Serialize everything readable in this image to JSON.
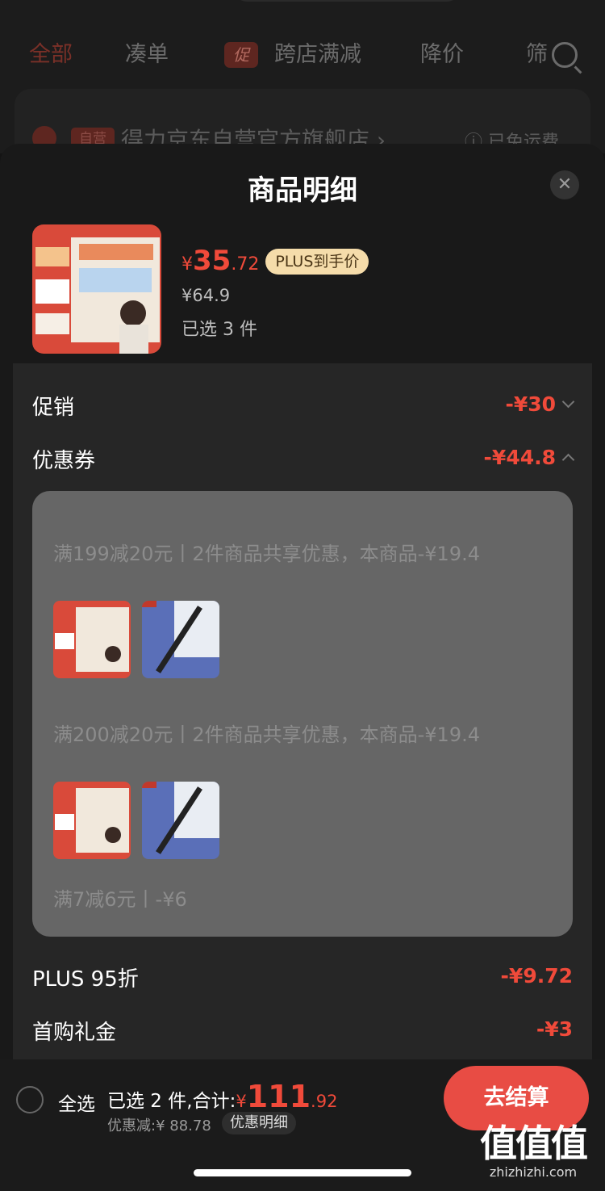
{
  "background": {
    "tabs": [
      "全部",
      "凑单",
      "跨店满减",
      "降价",
      "筛"
    ],
    "promo_badge": "促",
    "store": {
      "self_operated_tag": "自营",
      "name": "得力京东自营官方旗舰店 ›",
      "shipping": "ⓘ 已免运费"
    }
  },
  "sheet": {
    "title": "商品明细",
    "close_icon": "close-icon",
    "product": {
      "price_symbol": "¥",
      "price_int": "35",
      "price_dec": ".72",
      "price_tag": "PLUS到手价",
      "original_price": "¥64.9",
      "selected": "已选 3 件"
    },
    "rows": {
      "promo_label": "促销",
      "promo_value": "-¥30",
      "coupon_label": "优惠券",
      "coupon_value": "-¥44.8",
      "plus_label": "PLUS 95折",
      "plus_value": "-¥9.72",
      "first_label": "首购礼金",
      "first_value": "-¥3"
    },
    "coupons": [
      {
        "text": "满199减20元丨2件商品共享优惠，本商品-¥19.4"
      },
      {
        "text": "满200减20元丨2件商品共享优惠，本商品-¥19.4"
      },
      {
        "text": "满7减6元丨-¥6"
      }
    ]
  },
  "bottom": {
    "select_all": "全选",
    "total_prefix": "已选 2 件,合计:",
    "total_symbol": "¥",
    "total_int": "111",
    "total_dec": ".92",
    "discount": "优惠减:¥ 88.78",
    "detail_button": "优惠明细",
    "checkout_button": "去结算"
  },
  "watermark": {
    "glyphs": "值值值",
    "url": "zhizhizhi.com"
  },
  "colors": {
    "accent": "#f04a3a",
    "checkout": "#e84c44",
    "plus_tag": "#f5dcaa"
  }
}
